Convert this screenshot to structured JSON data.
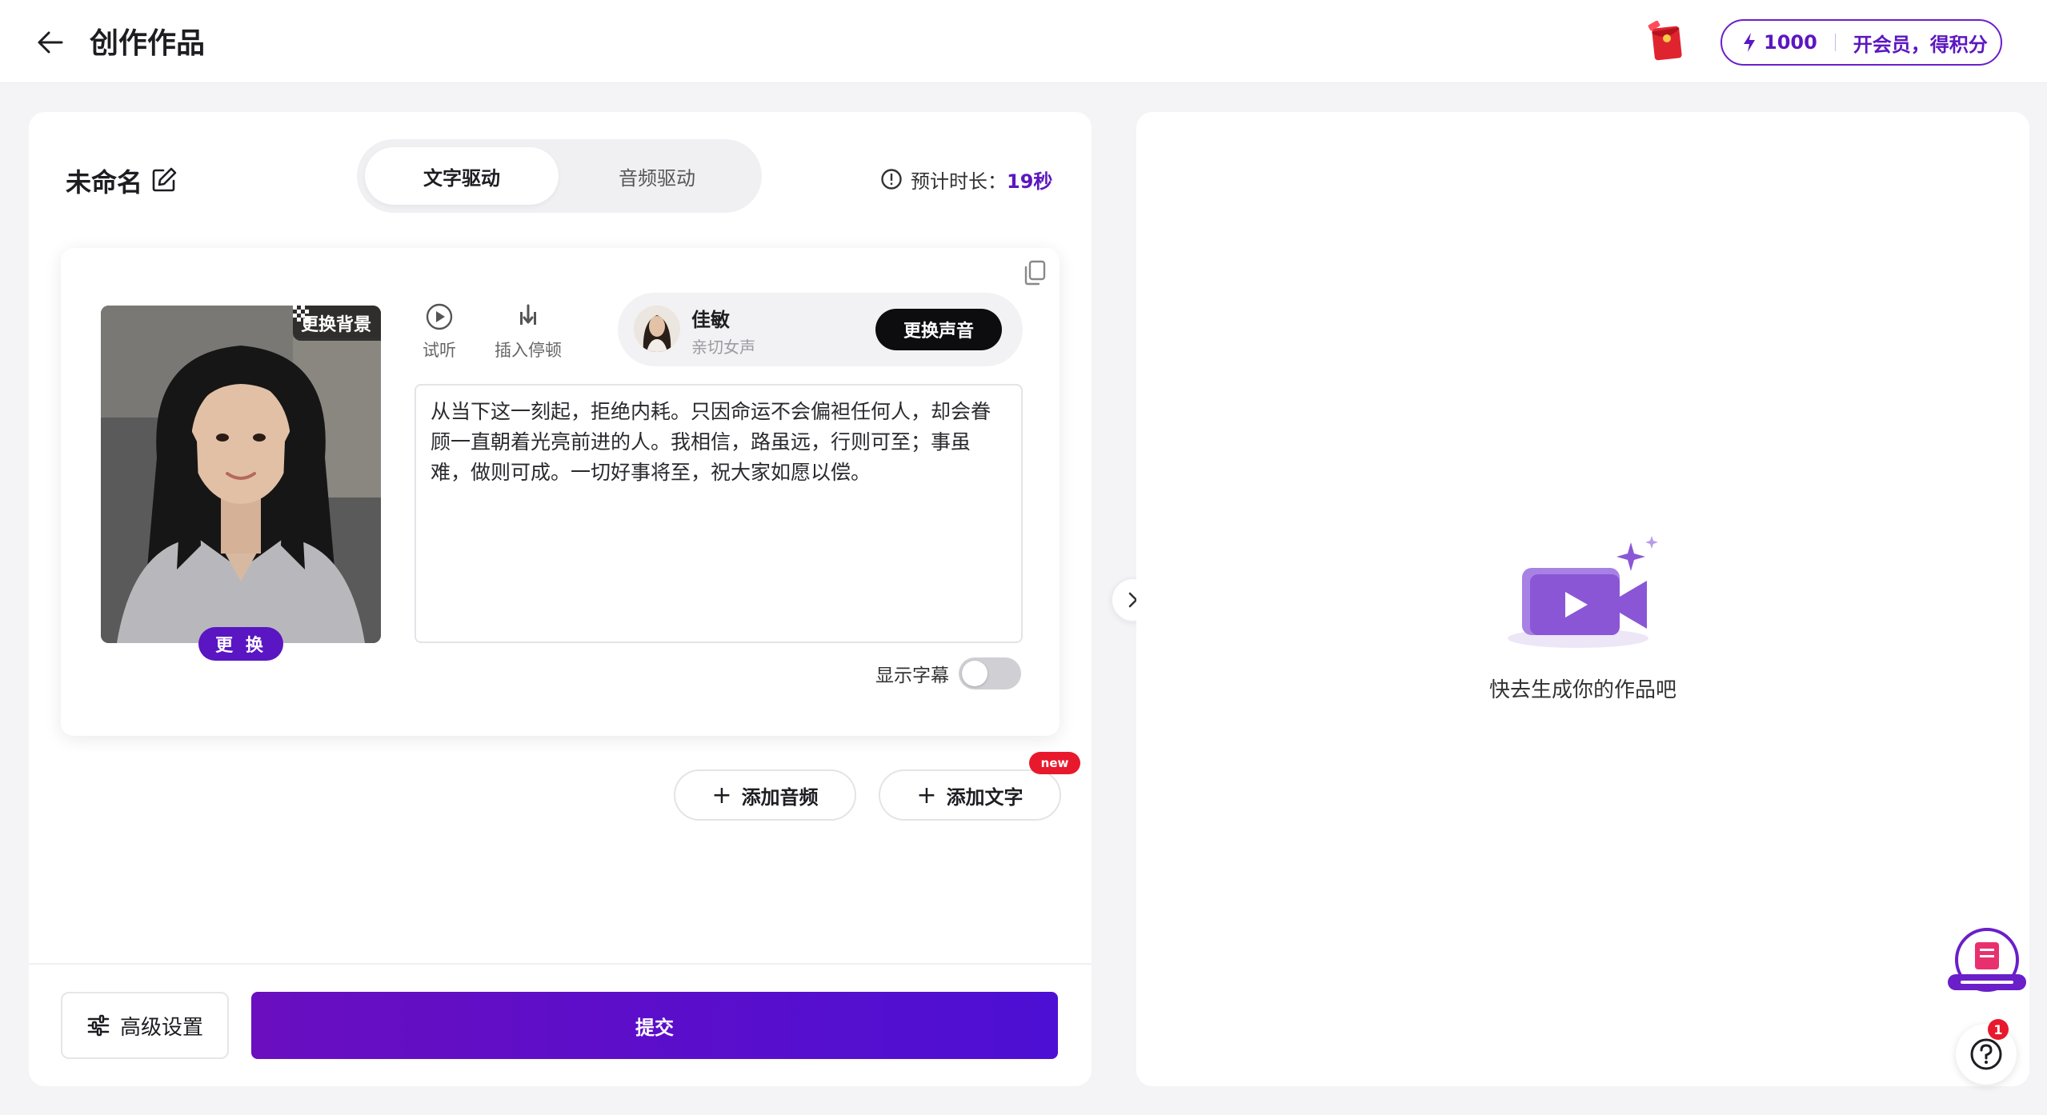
{
  "header": {
    "title": "创作作品",
    "credits": "1000",
    "vip_label": "开会员，得积分"
  },
  "work": {
    "name": "未命名",
    "modes": [
      "文字驱动",
      "音频驱动"
    ],
    "active_mode": "文字驱动",
    "duration_label": "预计时长：",
    "duration_value": "19秒"
  },
  "segment": {
    "change_background": "更换背景",
    "change_avatar": "更 换",
    "tools": {
      "listen": "试听",
      "insert_pause": "插入停顿"
    },
    "voice": {
      "name": "佳敏",
      "description": "亲切女声",
      "change_label": "更换声音"
    },
    "script_text": "从当下这一刻起，拒绝内耗。只因命运不会偏袒任何人，却会眷顾一直朝着光亮前进的人。我相信，路虽远，行则可至；事虽难，做则可成。一切好事将至，祝大家如愿以偿。",
    "subtitle_label": "显示字幕",
    "subtitle_on": false
  },
  "actions": {
    "add_audio": "添加音频",
    "add_text": "添加文字",
    "new_badge": "new",
    "advanced": "高级设置",
    "submit": "提交"
  },
  "preview": {
    "empty_text": "快去生成你的作品吧"
  },
  "help": {
    "badge_count": "1"
  },
  "colors": {
    "accent": "#5b17c0",
    "submit_gradient_start": "#6a0ec0",
    "submit_gradient_end": "#4d0fd4",
    "new_badge": "#e8192c"
  }
}
